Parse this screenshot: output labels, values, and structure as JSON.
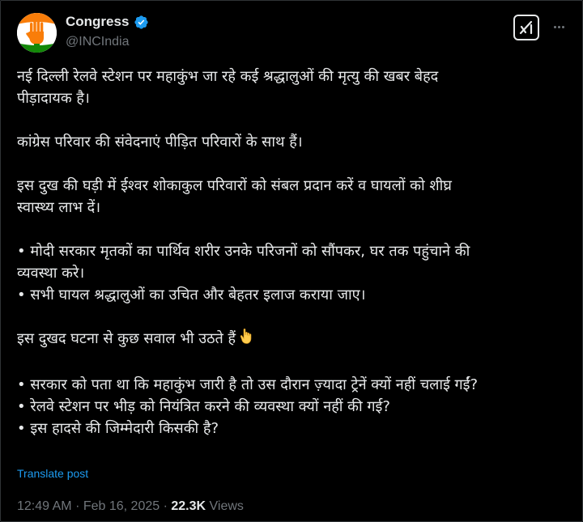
{
  "account": {
    "display_name": "Congress",
    "handle": "@INCIndia",
    "verified": true,
    "avatar_icon": "congress-hand-logo"
  },
  "actions": {
    "grok_icon": "grok-icon",
    "more_icon": "more-icon"
  },
  "post": {
    "lines": [
      "नई दिल्ली रेलवे स्टेशन पर महाकुंभ जा रहे कई श्रद्धालुओं की मृत्यु की खबर बेहद",
      "पीड़ादायक है।",
      "कांग्रेस परिवार की संवेदनाएं पीड़ित परिवारों के साथ हैं।",
      "इस दुख की घड़ी में ईश्वर शोकाकुल परिवारों को संबल प्रदान करें व घायलों को शीघ्र",
      "स्वास्थ्य लाभ दें।",
      "• मोदी सरकार मृतकों का पार्थिव शरीर उनके परिजनों को सौंपकर, घर तक पहुंचाने की",
      "व्यवस्था करे।",
      "• सभी घायल श्रद्धालुओं का उचित और बेहतर इलाज कराया जाए।",
      "इस दुखद घटना से कुछ सवाल भी उठते हैं",
      "• सरकार को पता था कि महाकुंभ जारी है तो उस दौरान ज़्यादा ट्रेनें क्यों नहीं चलाई गईं?",
      "• रेलवे स्टेशन पर भीड़ को नियंत्रित करने की व्यवस्था क्यों नहीं की गई?",
      "• इस हादसे की जिम्मेदारी किसकी है?"
    ],
    "emoji": "backhand-index-pointing-down"
  },
  "translate_label": "Translate post",
  "meta": {
    "time": "12:49 AM",
    "separator": "·",
    "date": "Feb 16, 2025",
    "views_count": "22.3K",
    "views_label": "Views"
  },
  "colors": {
    "background": "#000000",
    "text": "#e7e9ea",
    "secondary": "#71767b",
    "link": "#1d9bf0",
    "verified_badge": "#1d9bf0",
    "logo_saffron": "#f97d09",
    "logo_green": "#138808"
  }
}
